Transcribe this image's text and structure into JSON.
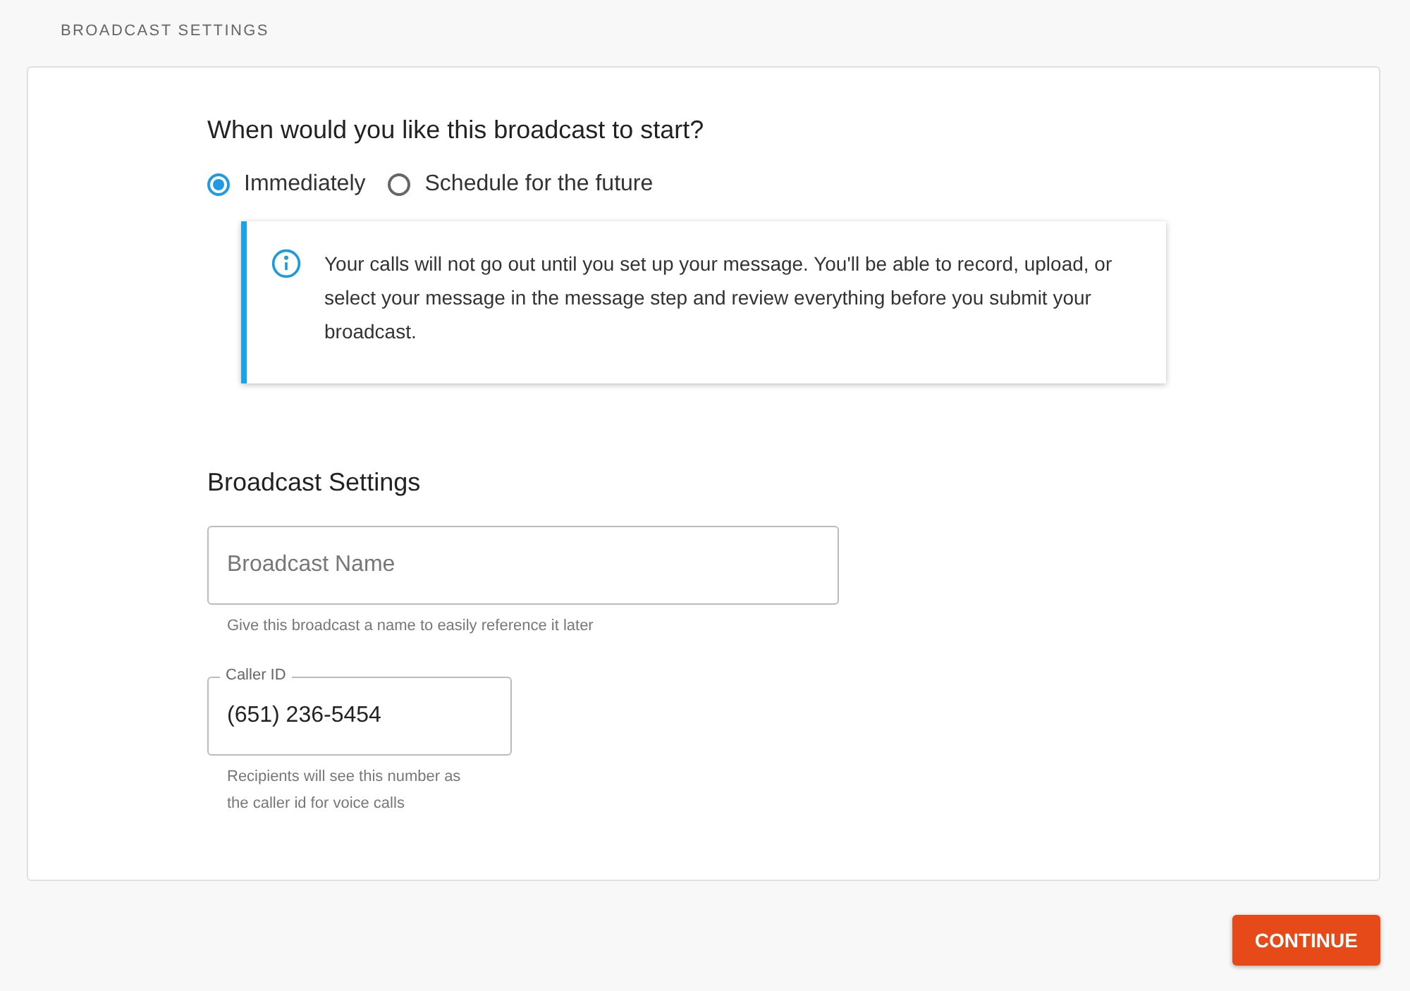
{
  "page_title": "BROADCAST SETTINGS",
  "start": {
    "question": "When would you like this broadcast to start?",
    "options": [
      {
        "label": "Immediately",
        "selected": true
      },
      {
        "label": "Schedule for the future",
        "selected": false
      }
    ],
    "info": "Your calls will not go out until you set up your message. You'll be able to record, upload, or select your message in the message step and review everything before you submit your broadcast."
  },
  "settings": {
    "title": "Broadcast Settings",
    "fields": [
      {
        "kind": "name",
        "placeholder": "Broadcast Name",
        "helper": "Give this broadcast a name to easily reference it later"
      },
      {
        "kind": "phone",
        "label": "Caller ID",
        "value": "(651) 236-5454",
        "helper": "Recipients will see this number as the caller id for voice calls"
      }
    ]
  },
  "continue_button": "CONTINUE"
}
